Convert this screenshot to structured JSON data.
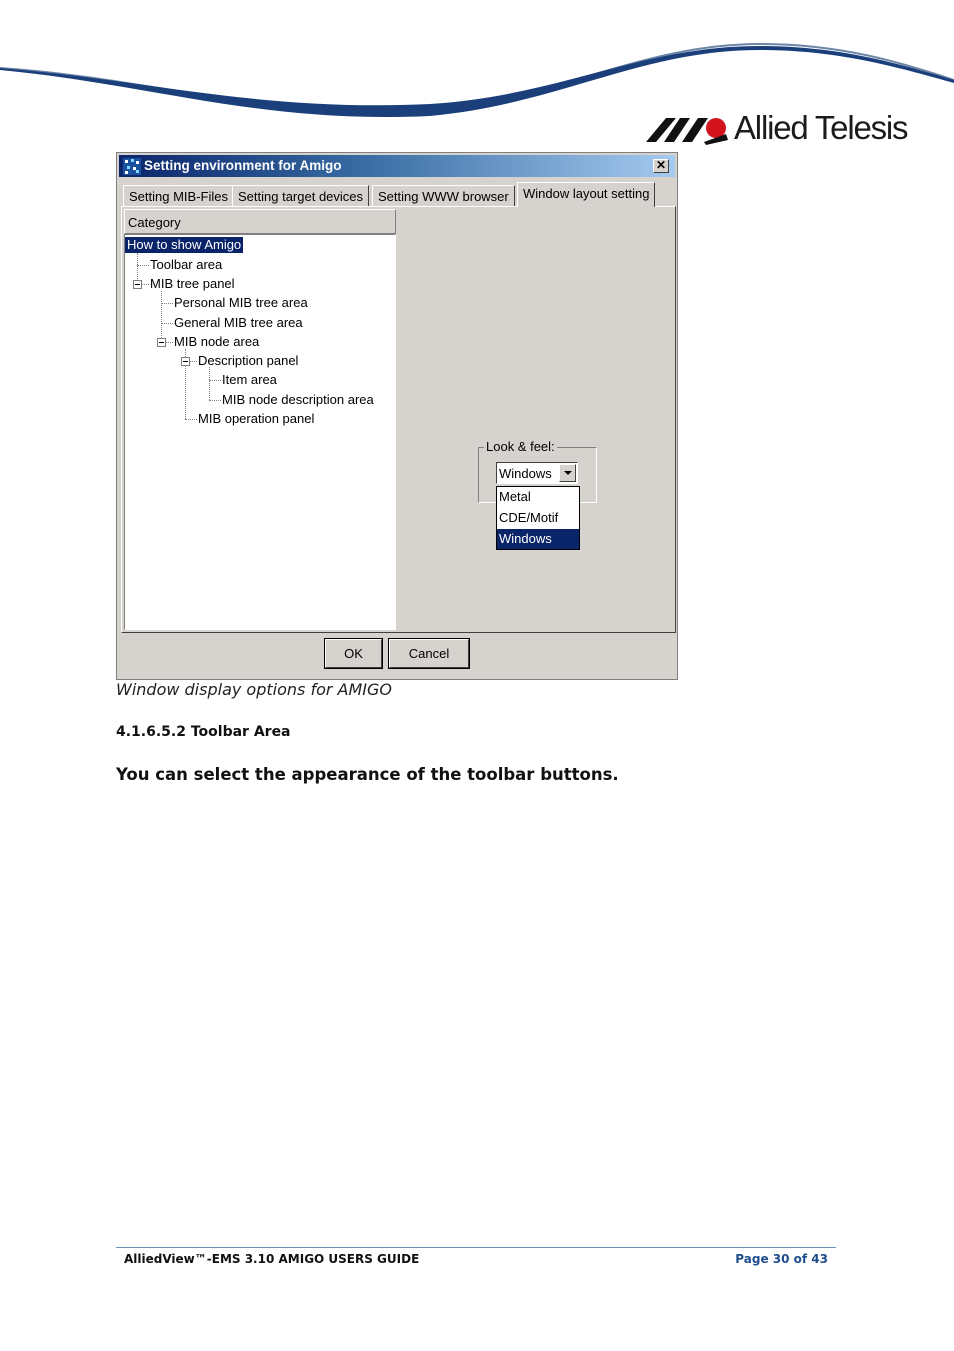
{
  "brand": {
    "name": "Allied Telesis"
  },
  "colors": {
    "accent_blue": "#1f4e8c",
    "title_bar": "#0a246a",
    "dialog_bg": "#d6d3ce",
    "swoosh": "#1a3f7a"
  },
  "dialog": {
    "title": "Setting environment for Amigo",
    "close_glyph": "✕",
    "tabs": [
      {
        "label": "Setting MIB-Files"
      },
      {
        "label": "Setting target devices"
      },
      {
        "label": "Setting WWW browser"
      },
      {
        "label": "Window layout setting"
      }
    ],
    "category_label": "Category",
    "tree": [
      {
        "label": "How to show Amigo",
        "selected": true
      },
      {
        "label": "Toolbar area"
      },
      {
        "label": "MIB tree panel"
      },
      {
        "label": "Personal MIB tree area"
      },
      {
        "label": "General MIB tree area"
      },
      {
        "label": "MIB node area"
      },
      {
        "label": "Description panel"
      },
      {
        "label": "Item area"
      },
      {
        "label": "MIB node description area"
      },
      {
        "label": "MIB operation panel"
      }
    ],
    "look_feel": {
      "label": "Look & feel:",
      "selected": "Windows",
      "options": [
        "Metal",
        "CDE/Motif",
        "Windows"
      ]
    },
    "ok_label": "OK",
    "cancel_label": "Cancel"
  },
  "caption": "Window display options for AMIGO",
  "section_heading": "4.1.6.5.2 Toolbar Area",
  "body_text": "You can select the appearance of the toolbar buttons.",
  "footer": {
    "left": "AlliedView™-EMS 3.10 AMIGO USERS GUIDE",
    "right": "Page 30 of 43"
  }
}
